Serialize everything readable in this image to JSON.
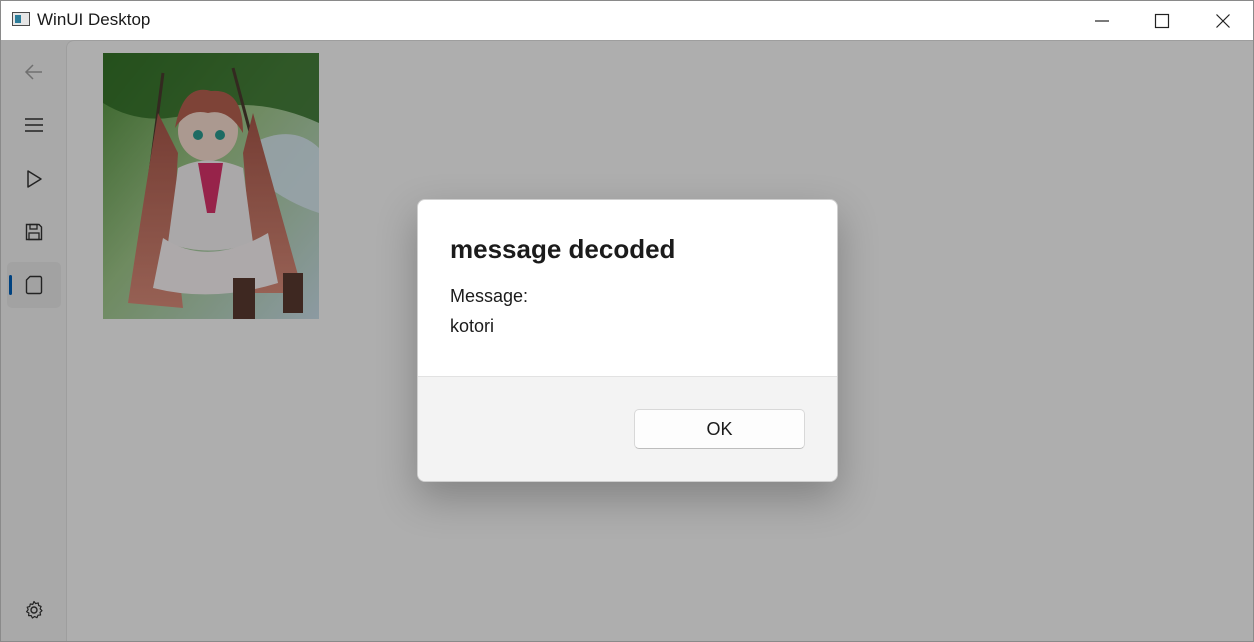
{
  "window": {
    "title": "WinUI Desktop",
    "minimize_icon": "minimize-icon",
    "maximize_icon": "maximize-icon",
    "close_icon": "close-icon"
  },
  "nav": {
    "items": [
      {
        "icon": "back-arrow-icon",
        "enabled": false
      },
      {
        "icon": "hamburger-menu-icon"
      },
      {
        "icon": "play-icon"
      },
      {
        "icon": "save-icon"
      },
      {
        "icon": "tablet-icon",
        "selected": true
      }
    ],
    "footer_icon": "gear-icon",
    "accent": "#005fb8"
  },
  "content": {
    "image": "anime-girl-on-swing-illustration"
  },
  "dialog": {
    "title": "message decoded",
    "message_label": "Message:",
    "message_value": "kotori",
    "ok_label": "OK"
  }
}
